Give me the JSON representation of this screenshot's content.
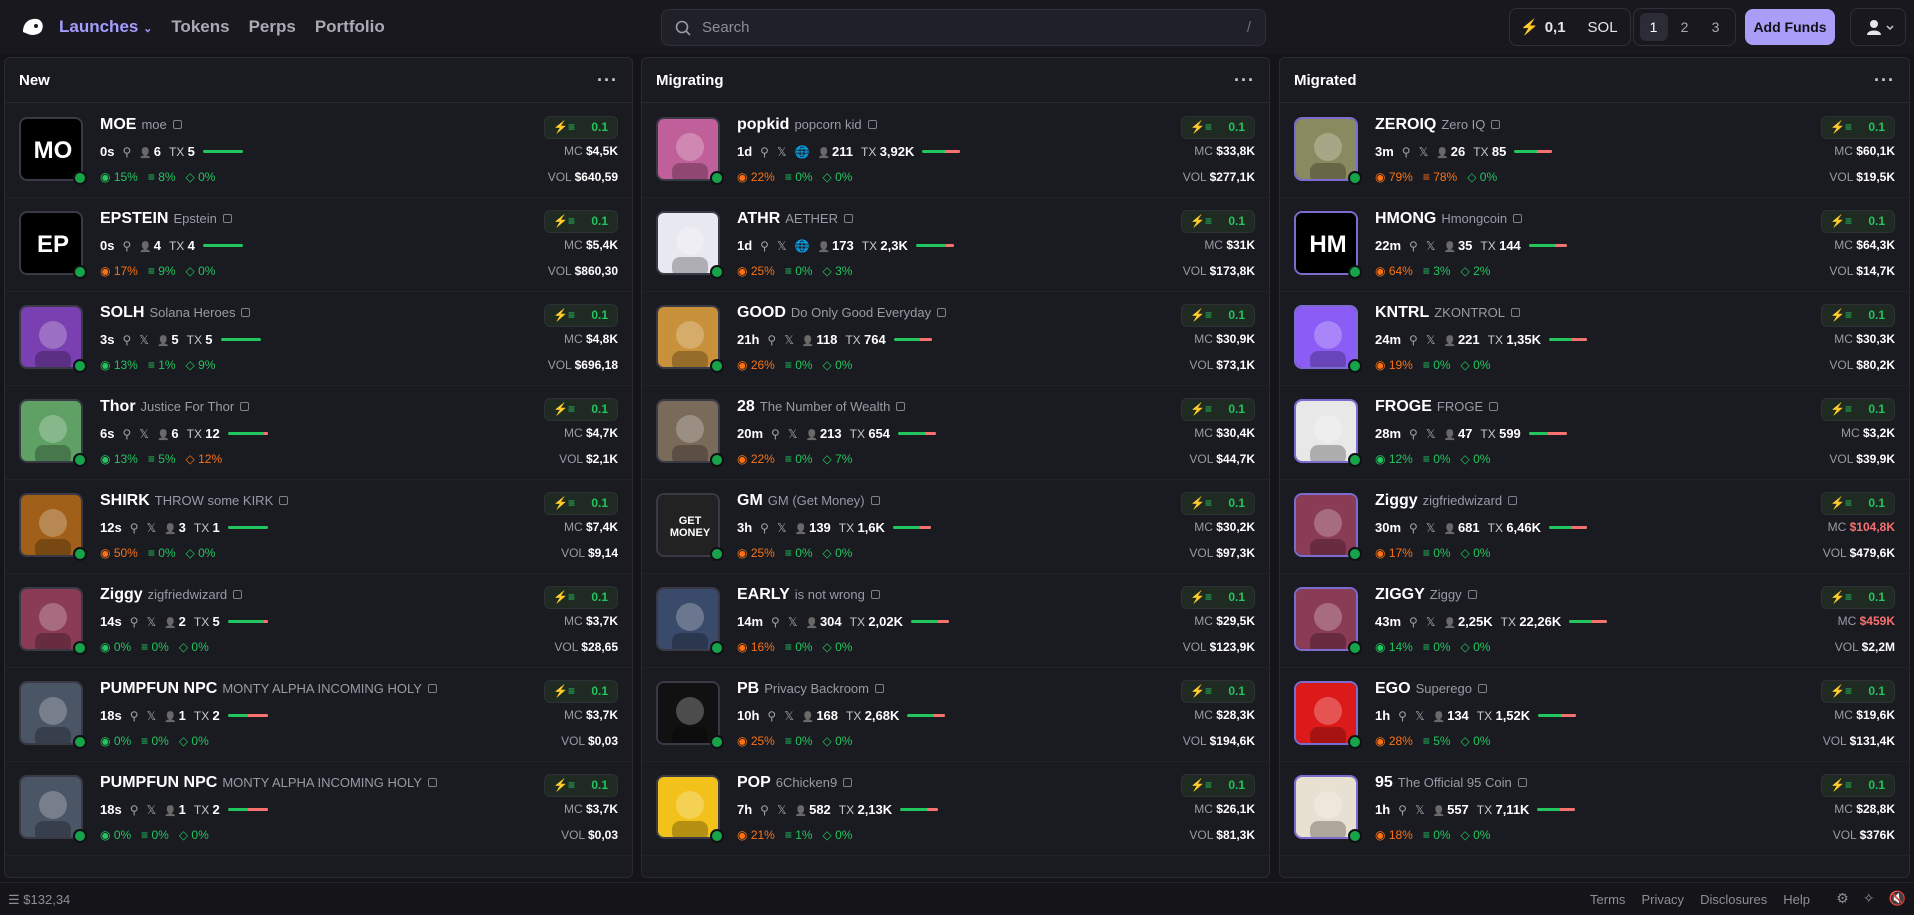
{
  "header": {
    "nav": [
      "Launches",
      "Tokens",
      "Perps",
      "Portfolio"
    ],
    "search_placeholder": "Search",
    "search_shortcut": "/",
    "sol_amount": "0,1",
    "sol_label": "SOL",
    "pages": [
      "1",
      "2",
      "3"
    ],
    "add_funds": "Add Funds"
  },
  "columns": [
    {
      "title": "New",
      "tokens": [
        {
          "sym": "MOE",
          "name": "moe",
          "age": "0s",
          "holders": "6",
          "tx": "5",
          "p1": "15%",
          "p2": "8%",
          "p3": "0%",
          "p1c": "g",
          "p3c": "g",
          "mc": "$4,5K",
          "vol": "$640,59",
          "buy": "0.1",
          "av": "MO",
          "avbg": "#000",
          "bar": 1.0
        },
        {
          "sym": "EPSTEIN",
          "name": "Epstein",
          "age": "0s",
          "holders": "4",
          "tx": "4",
          "p1": "17%",
          "p2": "9%",
          "p3": "0%",
          "p1c": "r",
          "p3c": "g",
          "mc": "$5,4K",
          "vol": "$860,30",
          "buy": "0.1",
          "av": "EP",
          "avbg": "#000",
          "bar": 1.0
        },
        {
          "sym": "SOLH",
          "name": "Solana Heroes",
          "age": "3s",
          "holders": "5",
          "tx": "5",
          "p1": "13%",
          "p2": "1%",
          "p3": "9%",
          "p1c": "g",
          "p3c": "g",
          "mc": "$4,8K",
          "vol": "$696,18",
          "buy": "0.1",
          "av": "",
          "avbg": "#7a3fb0",
          "bar": 1.0
        },
        {
          "sym": "Thor",
          "name": "Justice For Thor",
          "age": "6s",
          "holders": "6",
          "tx": "12",
          "p1": "13%",
          "p2": "5%",
          "p3": "12%",
          "p1c": "g",
          "p3c": "r",
          "mc": "$4,7K",
          "vol": "$2,1K",
          "buy": "0.1",
          "av": "",
          "avbg": "#5fa065",
          "bar": 0.9
        },
        {
          "sym": "SHIRK",
          "name": "THROW some KIRK",
          "age": "12s",
          "holders": "3",
          "tx": "1",
          "p1": "50%",
          "p2": "0%",
          "p3": "0%",
          "p1c": "r",
          "p3c": "g",
          "mc": "$7,4K",
          "vol": "$9,14",
          "buy": "0.1",
          "av": "",
          "avbg": "#a0601a",
          "bar": 1.0
        },
        {
          "sym": "Ziggy",
          "name": "zigfriedwizard",
          "age": "14s",
          "holders": "2",
          "tx": "5",
          "p1": "0%",
          "p2": "0%",
          "p3": "0%",
          "p1c": "g",
          "p3c": "g",
          "mc": "$3,7K",
          "vol": "$28,65",
          "buy": "0.1",
          "av": "",
          "avbg": "#8a3b55",
          "bar": 0.9
        },
        {
          "sym": "PUMPFUN NPC",
          "name": "MONTY ALPHA INCOMING HOLY",
          "age": "18s",
          "holders": "1",
          "tx": "2",
          "p1": "0%",
          "p2": "0%",
          "p3": "0%",
          "p1c": "g",
          "p3c": "g",
          "mc": "$3,7K",
          "vol": "$0,03",
          "buy": "0.1",
          "av": "",
          "avbg": "#4a5566",
          "bar": 0.5
        },
        {
          "sym": "PUMPFUN NPC",
          "name": "MONTY ALPHA INCOMING HOLY",
          "age": "18s",
          "holders": "1",
          "tx": "2",
          "p1": "0%",
          "p2": "0%",
          "p3": "0%",
          "p1c": "g",
          "p3c": "g",
          "mc": "$3,7K",
          "vol": "$0,03",
          "buy": "0.1",
          "av": "",
          "avbg": "#4a5566",
          "bar": 0.5
        }
      ]
    },
    {
      "title": "Migrating",
      "tokens": [
        {
          "sym": "popkid",
          "name": "popcorn kid",
          "age": "1d",
          "holders": "211",
          "tx": "3,92K",
          "p1": "22%",
          "p2": "0%",
          "p3": "0%",
          "p1c": "r",
          "p3c": "g",
          "mc": "$33,8K",
          "vol": "$277,1K",
          "buy": "0.1",
          "av": "",
          "avbg": "#c0609a",
          "bar": 0.6
        },
        {
          "sym": "ATHR",
          "name": "AETHER",
          "age": "1d",
          "holders": "173",
          "tx": "2,3K",
          "p1": "25%",
          "p2": "0%",
          "p3": "3%",
          "p1c": "r",
          "p3c": "g",
          "mc": "$31K",
          "vol": "$173,8K",
          "buy": "0.1",
          "av": "",
          "avbg": "#e8e8f0",
          "bar": 0.8
        },
        {
          "sym": "GOOD",
          "name": "Do Only Good Everyday",
          "age": "21h",
          "holders": "118",
          "tx": "764",
          "p1": "26%",
          "p2": "0%",
          "p3": "0%",
          "p1c": "r",
          "p3c": "g",
          "mc": "$30,9K",
          "vol": "$73,1K",
          "buy": "0.1",
          "av": "",
          "avbg": "#c8913a",
          "bar": 0.7
        },
        {
          "sym": "28",
          "name": "The Number of Wealth",
          "age": "20m",
          "holders": "213",
          "tx": "654",
          "p1": "22%",
          "p2": "0%",
          "p3": "7%",
          "p1c": "r",
          "p3c": "g",
          "mc": "$30,4K",
          "vol": "$44,7K",
          "buy": "0.1",
          "av": "",
          "avbg": "#7a6a5a",
          "bar": 0.7
        },
        {
          "sym": "GM",
          "name": "GM (Get Money)",
          "age": "3h",
          "holders": "139",
          "tx": "1,6K",
          "p1": "25%",
          "p2": "0%",
          "p3": "0%",
          "p1c": "r",
          "p3c": "g",
          "mc": "$30,2K",
          "vol": "$97,3K",
          "buy": "0.1",
          "av": "GET MONEY",
          "avbg": "#222",
          "bar": 0.7
        },
        {
          "sym": "EARLY",
          "name": "is not wrong",
          "age": "14m",
          "holders": "304",
          "tx": "2,02K",
          "p1": "16%",
          "p2": "0%",
          "p3": "0%",
          "p1c": "r",
          "p3c": "g",
          "mc": "$29,5K",
          "vol": "$123,9K",
          "buy": "0.1",
          "av": "",
          "avbg": "#3a4a6a",
          "bar": 0.7
        },
        {
          "sym": "PB",
          "name": "Privacy Backroom",
          "age": "10h",
          "holders": "168",
          "tx": "2,68K",
          "p1": "25%",
          "p2": "0%",
          "p3": "0%",
          "p1c": "r",
          "p3c": "g",
          "mc": "$28,3K",
          "vol": "$194,6K",
          "buy": "0.1",
          "av": "",
          "avbg": "#111",
          "bar": 0.7
        },
        {
          "sym": "POP",
          "name": "6Chicken9",
          "age": "7h",
          "holders": "582",
          "tx": "2,13K",
          "p1": "21%",
          "p2": "1%",
          "p3": "0%",
          "p1c": "r",
          "p3c": "g",
          "mc": "$26,1K",
          "vol": "$81,3K",
          "buy": "0.1",
          "av": "",
          "avbg": "#f2c21a",
          "bar": 0.7
        }
      ]
    },
    {
      "title": "Migrated",
      "tokens": [
        {
          "sym": "ZEROIQ",
          "name": "Zero IQ",
          "age": "3m",
          "holders": "26",
          "tx": "85",
          "p1": "79%",
          "p2": "78%",
          "p3": "0%",
          "p1c": "r",
          "p2c": "r",
          "p3c": "g",
          "mc": "$60,1K",
          "vol": "$19,5K",
          "buy": "0.1",
          "av": "",
          "avbg": "#8a8a60",
          "bar": 0.6
        },
        {
          "sym": "HMONG",
          "name": "Hmongcoin",
          "age": "22m",
          "holders": "35",
          "tx": "144",
          "p1": "64%",
          "p2": "3%",
          "p3": "2%",
          "p1c": "r",
          "p3c": "g",
          "mc": "$64,3K",
          "vol": "$14,7K",
          "buy": "0.1",
          "av": "HM",
          "avbg": "#000",
          "bar": 0.7
        },
        {
          "sym": "KNTRL",
          "name": "ZKONTROL",
          "age": "24m",
          "holders": "221",
          "tx": "1,35K",
          "p1": "19%",
          "p2": "0%",
          "p3": "0%",
          "p1c": "r",
          "p3c": "g",
          "mc": "$30,3K",
          "vol": "$80,2K",
          "buy": "0.1",
          "av": "",
          "avbg": "#8b5cf6",
          "bar": 0.6
        },
        {
          "sym": "FROGE",
          "name": "FROGE",
          "age": "28m",
          "holders": "47",
          "tx": "599",
          "p1": "12%",
          "p2": "0%",
          "p3": "0%",
          "p1c": "g",
          "p3c": "g",
          "mc": "$3,2K",
          "vol": "$39,9K",
          "buy": "0.1",
          "av": "",
          "avbg": "#e8e8e8",
          "bar": 0.5
        },
        {
          "sym": "Ziggy",
          "name": "zigfriedwizard",
          "age": "30m",
          "holders": "681",
          "tx": "6,46K",
          "p1": "17%",
          "p2": "0%",
          "p3": "0%",
          "p1c": "r",
          "p3c": "g",
          "mc": "$104,8K",
          "mcred": true,
          "vol": "$479,6K",
          "buy": "0.1",
          "av": "",
          "avbg": "#8a3b55",
          "bar": 0.6
        },
        {
          "sym": "ZIGGY",
          "name": "Ziggy",
          "age": "43m",
          "holders": "2,25K",
          "tx": "22,26K",
          "p1": "14%",
          "p2": "0%",
          "p3": "0%",
          "p1c": "g",
          "p3c": "g",
          "mc": "$459K",
          "mcred": true,
          "vol": "$2,2M",
          "buy": "0.1",
          "av": "",
          "avbg": "#8a3b55",
          "bar": 0.6
        },
        {
          "sym": "EGO",
          "name": "Superego",
          "age": "1h",
          "holders": "134",
          "tx": "1,52K",
          "p1": "28%",
          "p2": "5%",
          "p3": "0%",
          "p1c": "r",
          "p3c": "g",
          "mc": "$19,6K",
          "vol": "$131,4K",
          "buy": "0.1",
          "av": "",
          "avbg": "#dc1a1a",
          "bar": 0.6
        },
        {
          "sym": "95",
          "name": "The Official 95 Coin",
          "age": "1h",
          "holders": "557",
          "tx": "7,11K",
          "p1": "18%",
          "p2": "0%",
          "p3": "0%",
          "p1c": "r",
          "p3c": "g",
          "mc": "$28,8K",
          "vol": "$376K",
          "buy": "0.1",
          "av": "",
          "avbg": "#e8e0d0",
          "bar": 0.6
        }
      ]
    }
  ],
  "footer": {
    "balance": "$132,34",
    "links": [
      "Terms",
      "Privacy",
      "Disclosures",
      "Help"
    ]
  }
}
